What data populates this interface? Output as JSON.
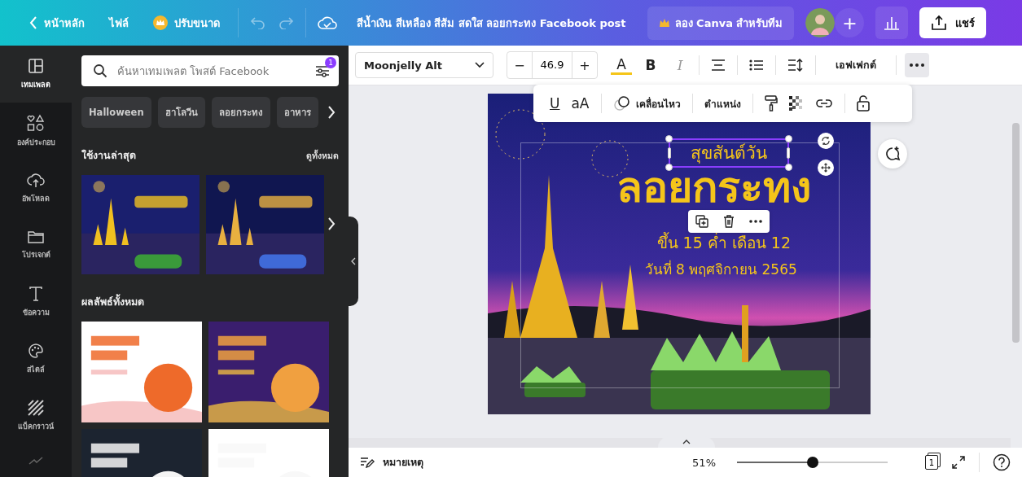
{
  "topbar": {
    "back": "หน้าหลัก",
    "file": "ไฟล์",
    "resize": "ปรับขนาด",
    "title": "สีน้ำเงิน สีเหลือง สีส้ม สดใส ลอยกระทง Facebook post",
    "team": "ลอง Canva สำหรับทีม",
    "add": "+",
    "share": "แชร์"
  },
  "sidebar": {
    "items": [
      {
        "kind": "templates",
        "label": "เทมเพลต",
        "selected": true
      },
      {
        "kind": "elements",
        "label": "องค์ประกอบ",
        "selected": false
      },
      {
        "kind": "uploads",
        "label": "อัพโหลด",
        "selected": false
      },
      {
        "kind": "projects",
        "label": "โปรเจกต์",
        "selected": false
      },
      {
        "kind": "text",
        "label": "ข้อความ",
        "selected": false
      },
      {
        "kind": "styles",
        "label": "สไตล์",
        "selected": false
      },
      {
        "kind": "background",
        "label": "แบ็คกราวน์",
        "selected": false
      },
      {
        "kind": "more",
        "selected": false
      }
    ]
  },
  "panel": {
    "search": {
      "placeholder": "ค้นหาเทมเพลต โพสต์ Facebook"
    },
    "filter_badge": "1",
    "chips": [
      "Halloween",
      "ฮาโลวีน",
      "ลอยกระทง",
      "อาหาร"
    ],
    "recent": {
      "heading": "ใช้งานล่าสุด",
      "see_all": "ดูทั้งหมด"
    },
    "results": {
      "heading": "ผลลัพธ์ทั้งหมด"
    }
  },
  "toolbar": {
    "font": "Moonjelly Alt",
    "minus": "−",
    "size": "46.9",
    "plus": "+",
    "text_color": "A",
    "bold": "B",
    "italic": "I",
    "effects": "เอฟเฟกต์"
  },
  "floating_toolbar": {
    "underline": "U",
    "case": "aA",
    "animate": "เคลื่อนไหว",
    "position": "ตำแหน่ง"
  },
  "design": {
    "texts": [
      {
        "kind": "subtitle",
        "text": "สุขสันต์วัน",
        "selected": true
      },
      {
        "kind": "title",
        "text": "ลอยกระทง",
        "selected": false
      },
      {
        "kind": "line1",
        "text": "ขึ้น 15 ค่ำ เดือน 12",
        "selected": false
      },
      {
        "kind": "line2",
        "text": "วันที่ 8 พฤศจิกายน 2565",
        "selected": false
      }
    ]
  },
  "bottombar": {
    "notes": "หมายเหตุ",
    "zoom": "51%",
    "zoom_slider": {
      "level": 0.5
    },
    "page_count": "1"
  }
}
